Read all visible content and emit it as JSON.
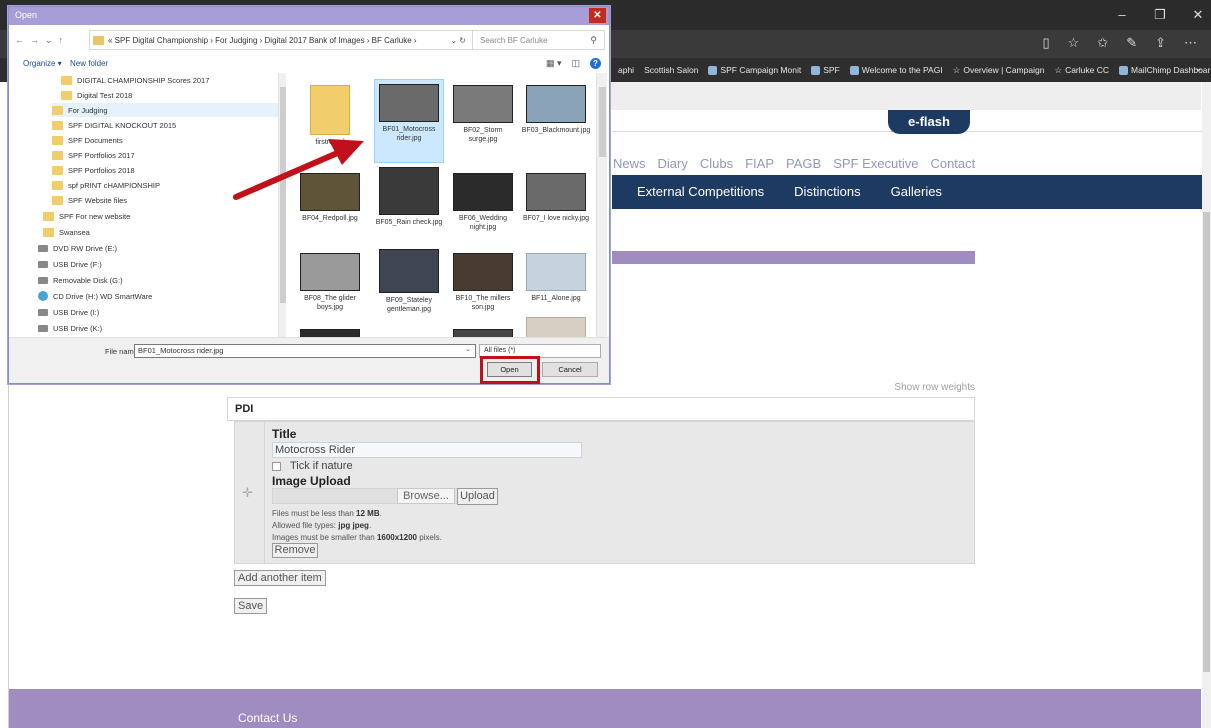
{
  "browser": {
    "window_controls": [
      "–",
      "❐",
      "✕"
    ],
    "toolbar_icons": [
      "reading-view",
      "favorites-star",
      "favorites-hub",
      "pen",
      "share",
      "more"
    ],
    "favorites": [
      {
        "label": "aphi"
      },
      {
        "label": "Scottish Salon"
      },
      {
        "label": "SPF Campaign Monit"
      },
      {
        "label": "SPF"
      },
      {
        "label": "Welcome to the PAGI"
      },
      {
        "label": "Overview | Campaign"
      },
      {
        "label": "Carluke CC"
      },
      {
        "label": "MailChimp Dashboar"
      }
    ],
    "fav_more": "⌄"
  },
  "site": {
    "eflash": "e-flash",
    "nav_links": [
      "News",
      "Diary",
      "Clubs",
      "FIAP",
      "PAGB",
      "SPF Executive",
      "Contact"
    ],
    "main_nav": [
      "External Competitions",
      "Distinctions",
      "Galleries"
    ],
    "show_row_weights": "Show row weights",
    "pdi_header": "PDI",
    "drag_handle": "✛",
    "form": {
      "title_label": "Title",
      "title_value": "Motocross Rider",
      "nature_label": "Tick if nature",
      "upload_label": "Image Upload",
      "browse": "Browse...",
      "upload": "Upload",
      "help_size_pre": "Files must be less than ",
      "help_size_val": "12 MB",
      "help_size_post": ".",
      "help_types_pre": "Allowed file types: ",
      "help_types_val": "jpg jpeg",
      "help_types_post": ".",
      "help_dims_pre": "Images must be smaller than ",
      "help_dims_val": "1600x1200",
      "help_dims_post": " pixels.",
      "remove": "Remove",
      "add_item": "Add another item",
      "save": "Save"
    },
    "footer": "Contact Us"
  },
  "dialog": {
    "title": "Open",
    "close": "✕",
    "nav_arrows": [
      "←",
      "→",
      "⌄",
      "↑"
    ],
    "path": "«  SPF Digital Championship  ›  For Judging  ›  Digital 2017 Bank of Images  ›  BF Carluke  ›",
    "path_controls": "⌄  ↻",
    "search_placeholder": "Search BF Carluke",
    "organize": "Organize ▾",
    "new_folder": "New folder",
    "toolbar_icons": [
      "▦ ▾",
      "◫",
      "?"
    ],
    "nav_items": [
      {
        "label": "DIGITAL CHAMPIONSHIP Scores 2017",
        "kind": "folder"
      },
      {
        "label": "Digital Test 2018",
        "kind": "folder"
      },
      {
        "label": "For Judging",
        "kind": "folder"
      },
      {
        "label": "SPF DIGITAL KNOCKOUT 2015",
        "kind": "folder"
      },
      {
        "label": "SPF Documents",
        "kind": "folder"
      },
      {
        "label": "SPF Portfolios 2017",
        "kind": "folder"
      },
      {
        "label": "SPF Portfolios 2018",
        "kind": "folder"
      },
      {
        "label": "spf pRINT cHAMPIONSHIP",
        "kind": "folder"
      },
      {
        "label": "SPF Website files",
        "kind": "folder"
      },
      {
        "label": "SPF For new website",
        "kind": "folder"
      },
      {
        "label": "Swansea",
        "kind": "folder"
      },
      {
        "label": "DVD RW Drive (E:)",
        "kind": "drive"
      },
      {
        "label": "USB Drive (F:)",
        "kind": "drive"
      },
      {
        "label": "Removable Disk (G:)",
        "kind": "drive"
      },
      {
        "label": "CD Drive (H:) WD SmartWare",
        "kind": "cd"
      },
      {
        "label": "USB Drive (I:)",
        "kind": "drive"
      },
      {
        "label": "USB Drive (K:)",
        "kind": "drive"
      }
    ],
    "files": [
      {
        "label": "firstround"
      },
      {
        "label": "BF01_Motocross rider.jpg"
      },
      {
        "label": "BF02_Storm surge.jpg"
      },
      {
        "label": "BF03_Blackmount.jpg"
      },
      {
        "label": "BF04_Redpoll.jpg"
      },
      {
        "label": "BF05_Rain check.jpg"
      },
      {
        "label": "BF06_Wedding night.jpg"
      },
      {
        "label": "BF07_I love nicky.jpg"
      },
      {
        "label": "BF08_The glider boys.jpg"
      },
      {
        "label": "BF09_Stateley gentleman.jpg"
      },
      {
        "label": "BF10_The millers son.jpg"
      },
      {
        "label": "BF11_Alone.jpg"
      }
    ],
    "file_name_label": "File name:",
    "file_name_value": "BF01_Motocross rider.jpg",
    "file_name_drop": "⌄",
    "file_type": "All files (*)",
    "open": "Open",
    "cancel": "Cancel"
  },
  "colors": {
    "navy": "#1d3a63",
    "purple": "#a08cc0",
    "dialog_title": "#a99dd8",
    "highlight_red": "#c0111a"
  }
}
